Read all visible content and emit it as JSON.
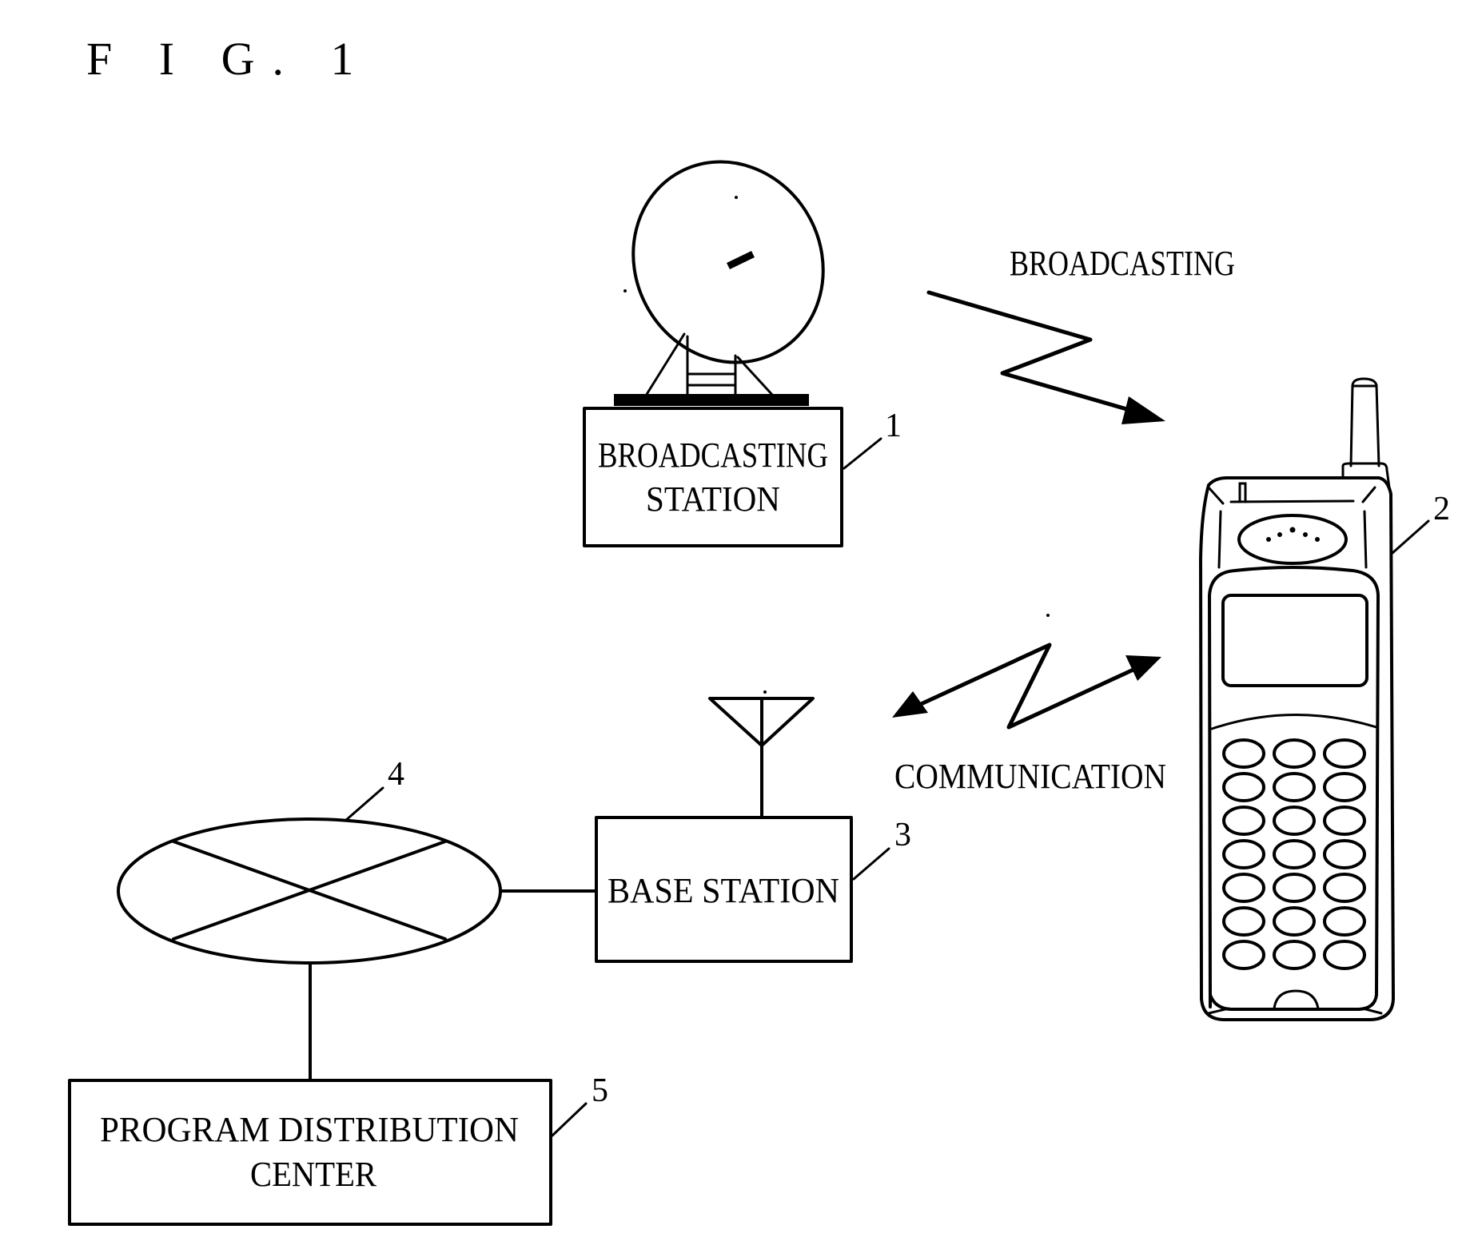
{
  "figure": {
    "title": "F I G. 1"
  },
  "nodes": {
    "broadcasting_station": {
      "ref": "1",
      "lines": [
        "BROADCASTING",
        "STATION"
      ]
    },
    "mobile_phone": {
      "ref": "2"
    },
    "base_station": {
      "ref": "3",
      "lines": [
        "BASE STATION"
      ]
    },
    "network": {
      "ref": "4"
    },
    "program_distribution_center": {
      "ref": "5",
      "lines": [
        "PROGRAM DISTRIBUTION",
        "CENTER"
      ]
    }
  },
  "links": {
    "broadcasting": {
      "label": "BROADCASTING",
      "direction": "one-way"
    },
    "communication": {
      "label": "COMMUNICATION",
      "direction": "two-way"
    }
  },
  "phone_keypad": {
    "rows": 7,
    "cols": 3
  }
}
